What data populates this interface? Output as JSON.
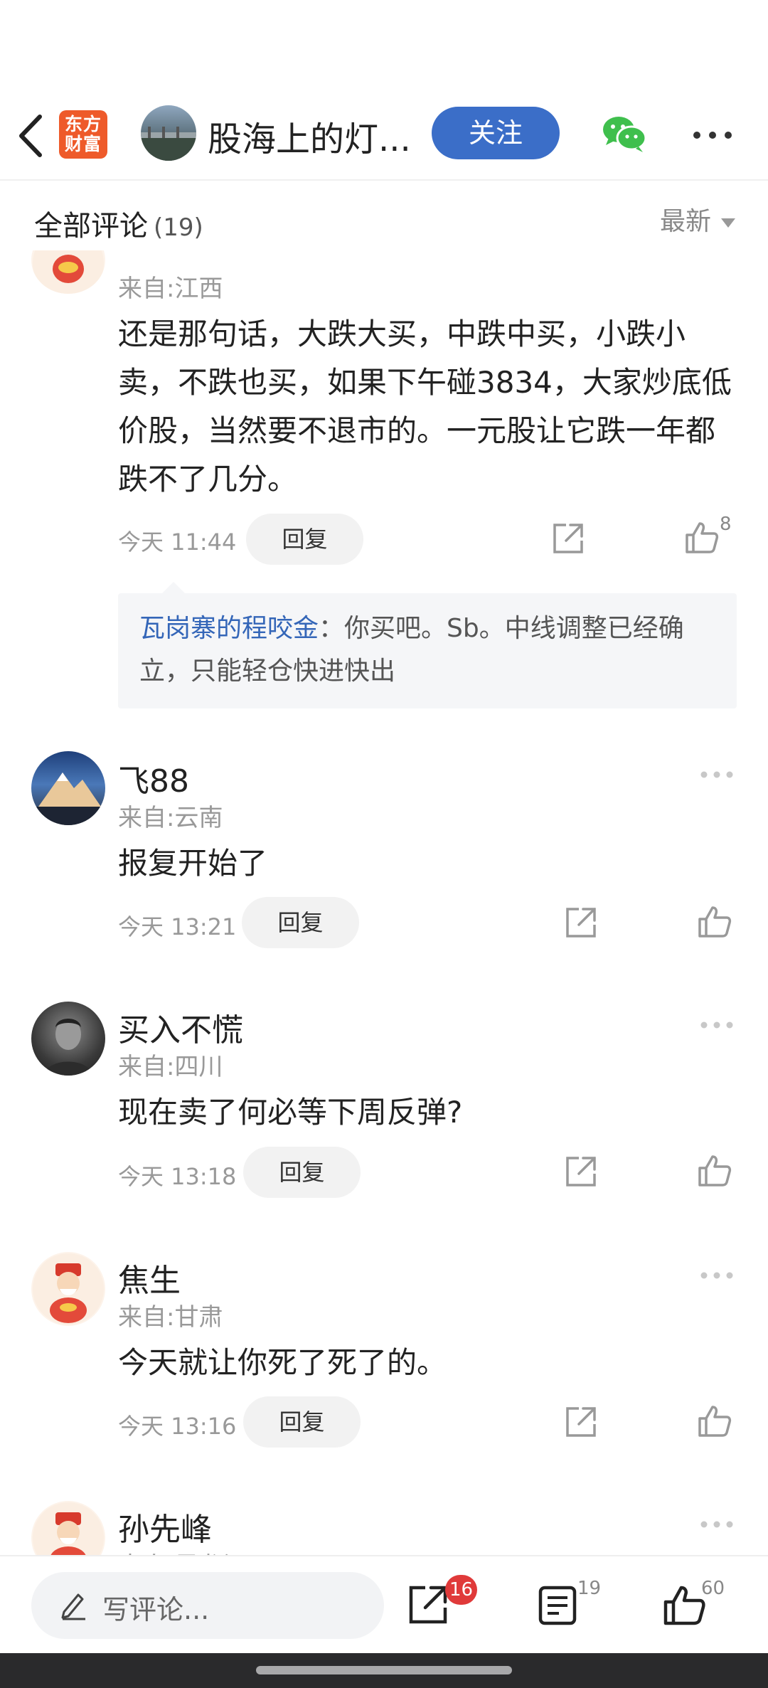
{
  "header": {
    "app_logo_text": "东方财富",
    "author_name": "股海上的灯...",
    "follow_label": "关注"
  },
  "comments_header": {
    "title": "全部评论",
    "count": "(19)",
    "sort_label": "最新"
  },
  "comments": [
    {
      "name": "",
      "location": "来自:江西",
      "text": "还是那句话，大跌大买，中跌中买，小跌小卖，不跌也买，如果下午碰3834，大家炒底低价股，当然要不退市的。一元股让它跌一年都跌不了几分。",
      "time": "今天 11:44",
      "reply_label": "回复",
      "like_count": "8",
      "quoted_reply": {
        "user": "瓦岗寨的程咬金",
        "text": "：你买吧。Sb。中线调整已经确立，只能轻仓快进快出"
      }
    },
    {
      "name": "飞88",
      "location": "来自:云南",
      "text": "报复开始了",
      "time": "今天 13:21",
      "reply_label": "回复"
    },
    {
      "name": "买入不慌",
      "location": "来自:四川",
      "text": "现在卖了何必等下周反弹?",
      "time": "今天 13:18",
      "reply_label": "回复"
    },
    {
      "name": "焦生",
      "location": "来自:甘肃",
      "text": "今天就让你死了死了的。",
      "time": "今天 13:16",
      "reply_label": "回复"
    },
    {
      "name": "孙先峰",
      "location": "来自:黑龙江"
    }
  ],
  "bottom_bar": {
    "write_placeholder": "写评论...",
    "share_badge": "16",
    "comment_count": "19",
    "like_count": "60"
  }
}
